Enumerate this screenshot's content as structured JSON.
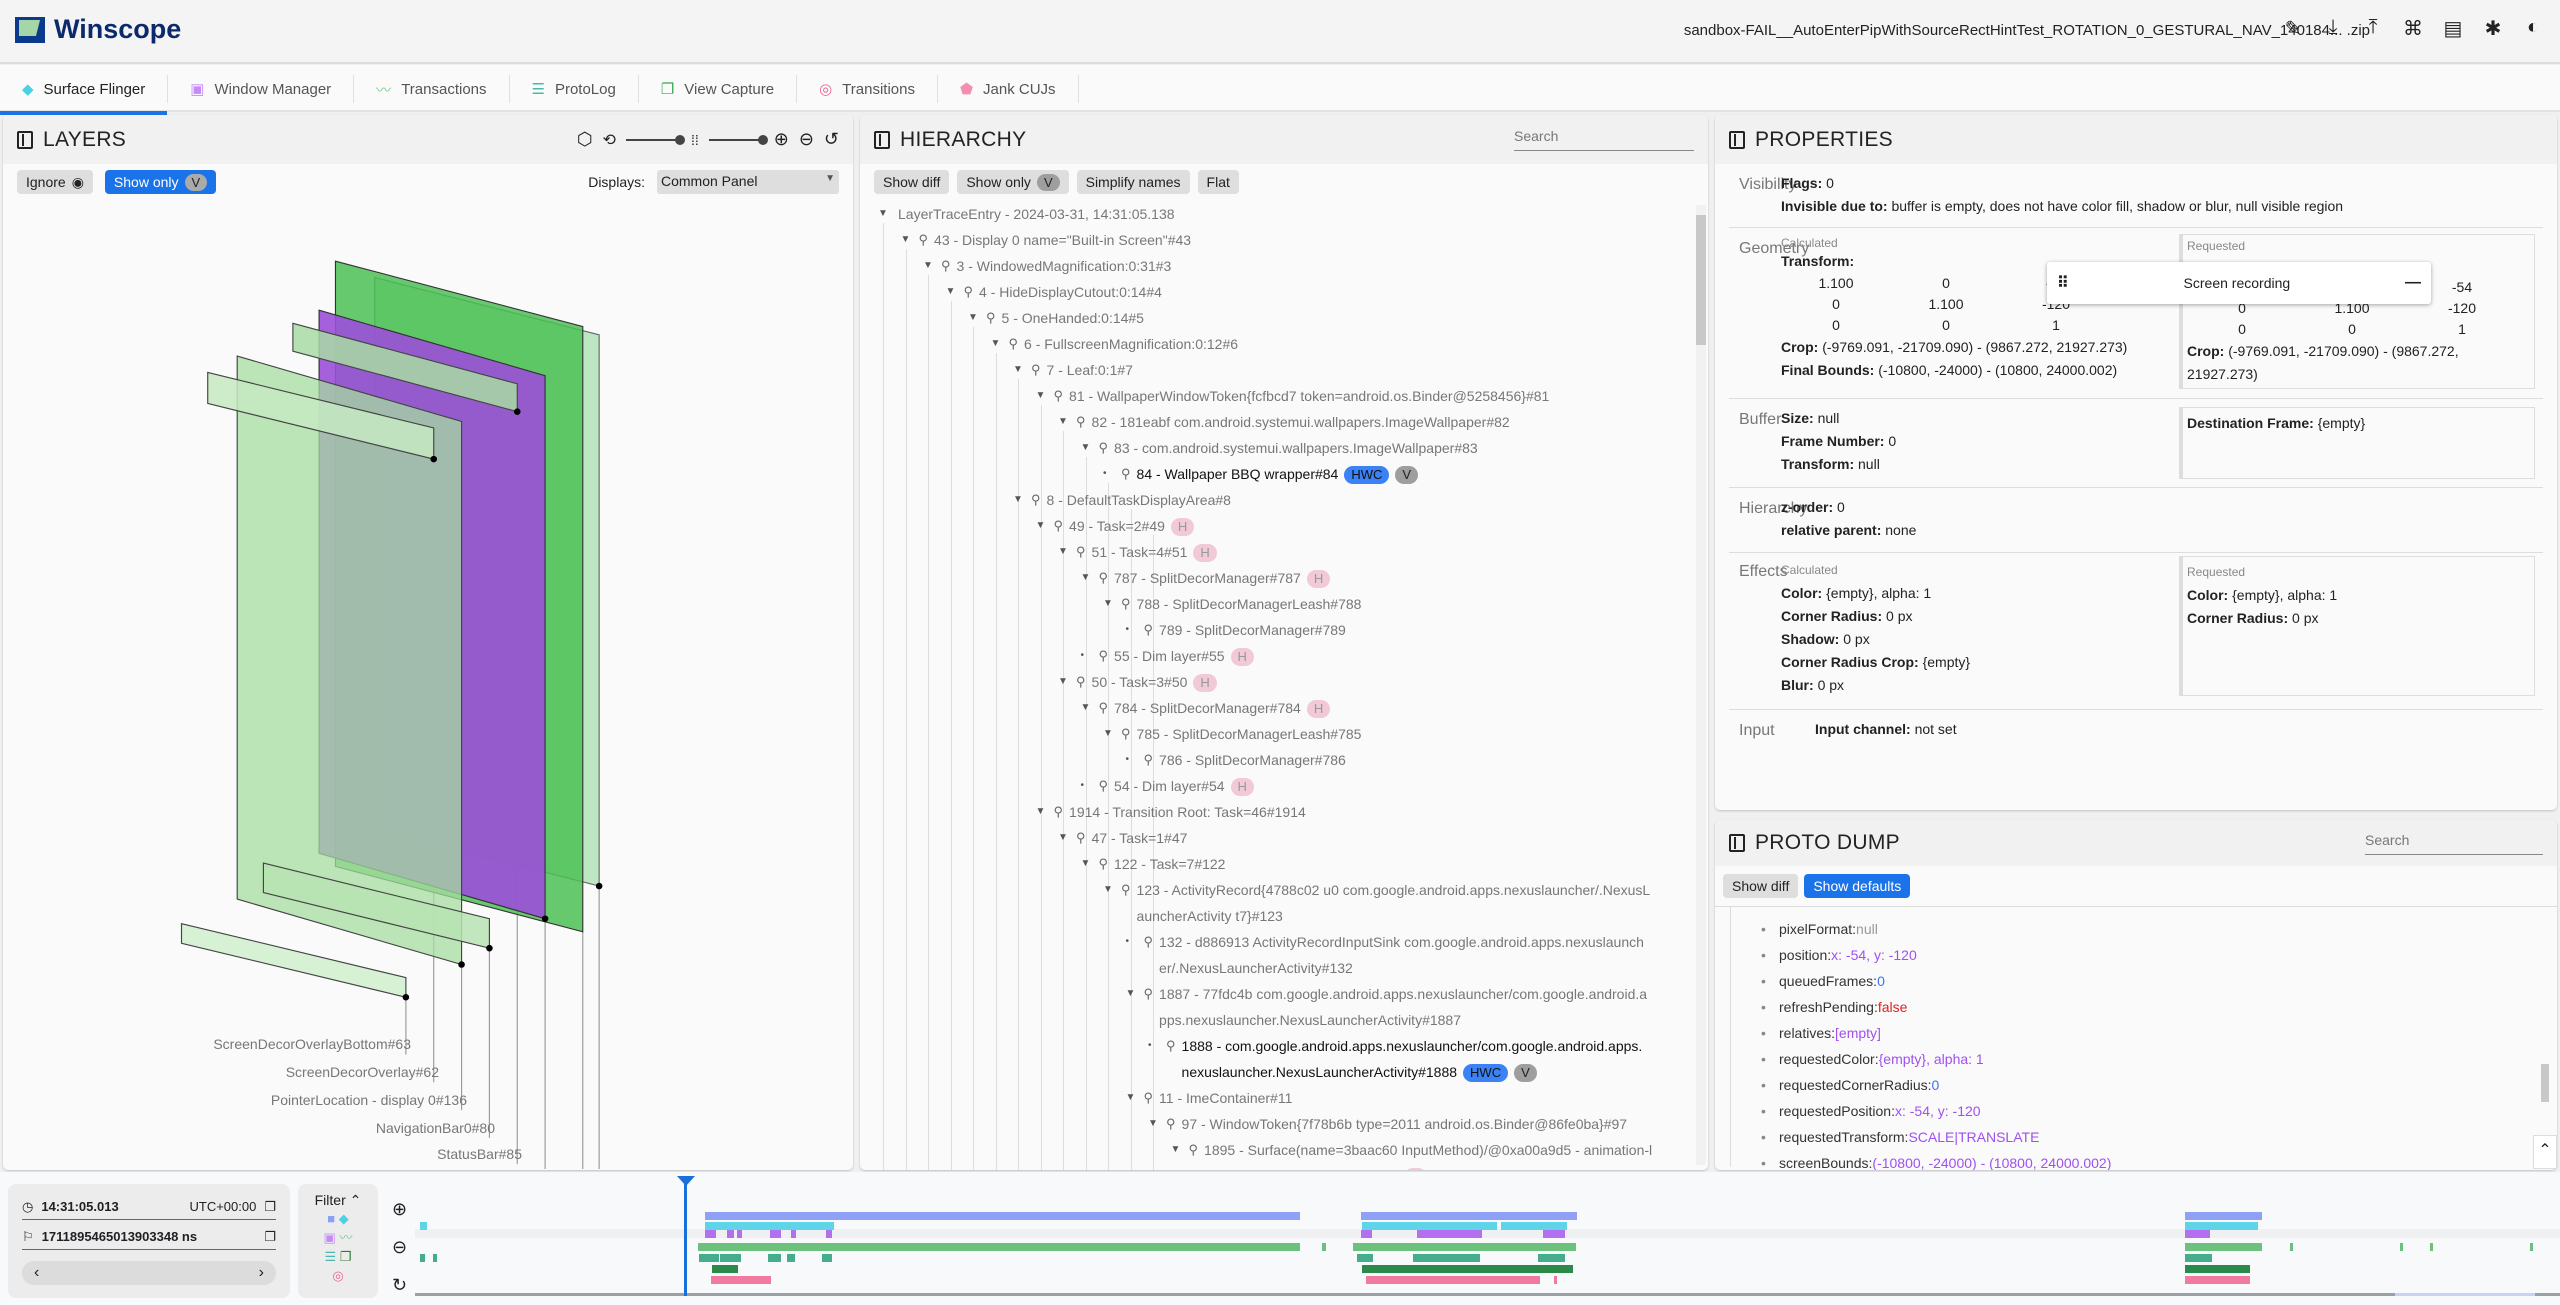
{
  "app": {
    "title": "Winscope",
    "file_name": "sandbox-FAIL__AutoEnterPipWithSourceRectHintTest_ROTATION_0_GESTURAL_NAV_140184... .zip",
    "toolbar_icons": [
      "edit-icon",
      "download-icon",
      "upload-icon",
      "shortcuts-icon",
      "docs-icon",
      "bug-icon",
      "dark-mode-icon"
    ]
  },
  "tabs": [
    {
      "label": "Surface Flinger",
      "icon": "layers-icon",
      "color": "#4dd0e1",
      "active": true
    },
    {
      "label": "Window Manager",
      "icon": "window-icon",
      "color": "#c58af9"
    },
    {
      "label": "Transactions",
      "icon": "chart-line-icon",
      "color": "#81c995"
    },
    {
      "label": "ProtoLog",
      "icon": "list-icon",
      "color": "#4db6ac"
    },
    {
      "label": "View Capture",
      "icon": "copy-icon",
      "color": "#34a853"
    },
    {
      "label": "Transitions",
      "icon": "rings-icon",
      "color": "#f06292"
    },
    {
      "label": "Jank CUJs",
      "icon": "tag-icon",
      "color": "#f48fb1"
    }
  ],
  "layers": {
    "title": "LAYERS",
    "ignore_label": "Ignore",
    "show_only_label": "Show only",
    "show_only_chip": "V",
    "displays_label": "Displays:",
    "displays_value": "Common Panel",
    "labels": [
      "ScreenDecorOverlayBottom#63",
      "ScreenDecorOverlay#62",
      "PointerLocation - display 0#136",
      "NavigationBar0#80",
      "StatusBar#85"
    ]
  },
  "hierarchy": {
    "title": "HIERARCHY",
    "search_placeholder": "Search",
    "buttons": [
      "Show diff",
      "Show only",
      "Simplify names",
      "Flat"
    ],
    "show_only_chip": "V",
    "rows": [
      {
        "d": 0,
        "t": "LayerTraceEntry - 2024-03-31, 14:31:05.138",
        "exp": true,
        "nopin": true
      },
      {
        "d": 1,
        "t": "43 - Display 0 name=\"Built-in Screen\"#43",
        "exp": true
      },
      {
        "d": 2,
        "t": "3 - WindowedMagnification:0:31#3",
        "exp": true
      },
      {
        "d": 3,
        "t": "4 - HideDisplayCutout:0:14#4",
        "exp": true
      },
      {
        "d": 4,
        "t": "5 - OneHanded:0:14#5",
        "exp": true
      },
      {
        "d": 5,
        "t": "6 - FullscreenMagnification:0:12#6",
        "exp": true
      },
      {
        "d": 6,
        "t": "7 - Leaf:0:1#7",
        "exp": true
      },
      {
        "d": 7,
        "t": "81 - WallpaperWindowToken{fcfbcd7 token=android.os.Binder@5258456}#81",
        "exp": true
      },
      {
        "d": 8,
        "t": "82 - 181eabf com.android.systemui.wallpapers.ImageWallpaper#82",
        "exp": true
      },
      {
        "d": 9,
        "t": "83 - com.android.systemui.wallpapers.ImageWallpaper#83",
        "exp": true
      },
      {
        "d": 10,
        "t": "84 - Wallpaper BBQ wrapper#84",
        "sel": true,
        "chips": [
          "HWC",
          "V"
        ]
      },
      {
        "d": 6,
        "t": "8 - DefaultTaskDisplayArea#8",
        "exp": true
      },
      {
        "d": 7,
        "t": "49 - Task=2#49",
        "exp": true,
        "chips": [
          "H"
        ]
      },
      {
        "d": 8,
        "t": "51 - Task=4#51",
        "exp": true,
        "chips": [
          "H"
        ]
      },
      {
        "d": 9,
        "t": "787 - SplitDecorManager#787",
        "exp": true,
        "chips": [
          "H"
        ]
      },
      {
        "d": 10,
        "t": "788 - SplitDecorManagerLeash#788",
        "exp": true
      },
      {
        "d": 11,
        "t": "789 - SplitDecorManager#789"
      },
      {
        "d": 9,
        "t": "55 - Dim layer#55",
        "chips": [
          "H"
        ]
      },
      {
        "d": 8,
        "t": "50 - Task=3#50",
        "exp": true,
        "chips": [
          "H"
        ]
      },
      {
        "d": 9,
        "t": "784 - SplitDecorManager#784",
        "exp": true,
        "chips": [
          "H"
        ]
      },
      {
        "d": 10,
        "t": "785 - SplitDecorManagerLeash#785",
        "exp": true
      },
      {
        "d": 11,
        "t": "786 - SplitDecorManager#786"
      },
      {
        "d": 9,
        "t": "54 - Dim layer#54",
        "chips": [
          "H"
        ]
      },
      {
        "d": 7,
        "t": "1914 - Transition Root: Task=46#1914",
        "exp": true
      },
      {
        "d": 8,
        "t": "47 - Task=1#47",
        "exp": true
      },
      {
        "d": 9,
        "t": "122 - Task=7#122",
        "exp": true
      },
      {
        "d": 10,
        "t": "123 - ActivityRecord{4788c02 u0 com.google.android.apps.nexuslauncher/.NexusL",
        "t2": "auncherActivity t7}#123",
        "exp": true
      },
      {
        "d": 11,
        "t": "132 - d886913 ActivityRecordInputSink com.google.android.apps.nexuslaunch",
        "t2": "er/.NexusLauncherActivity#132"
      },
      {
        "d": 11,
        "t": "1887 - 77fdc4b com.google.android.apps.nexuslauncher/com.google.android.a",
        "t2": "pps.nexuslauncher.NexusLauncherActivity#1887",
        "exp": true
      },
      {
        "d": 12,
        "t": "1888 - com.google.android.apps.nexuslauncher/com.google.android.apps.",
        "t2": "nexuslauncher.NexusLauncherActivity#1888",
        "sel": true,
        "chips": [
          "HWC",
          "V"
        ]
      },
      {
        "d": 11,
        "t": "11 - ImeContainer#11",
        "exp": true
      },
      {
        "d": 12,
        "t": "97 - WindowToken{7f78b6b type=2011 android.os.Binder@86fe0ba}#97",
        "exp": true
      },
      {
        "d": 13,
        "t": "1895 - Surface(name=3baac60 InputMethod)/@0xa00a9d5 - animation-l",
        "t2": "eash of insets_animation#1895",
        "exp": true,
        "chips": [
          "H"
        ]
      }
    ]
  },
  "properties": {
    "title": "PROPERTIES",
    "visibility": {
      "label": "Visibility",
      "flags": "Flags:",
      "flags_v": "0",
      "invis": "Invisible due to:",
      "invis_v": "buffer is empty, does not have color fill, shadow or blur, null visible region"
    },
    "geometry": {
      "label": "Geometry",
      "calc": "Calculated",
      "req": "Requested",
      "transform": "Transform:",
      "calc_matrix": [
        "1.100",
        "0",
        "-54",
        "0",
        "1.100",
        "-120",
        "0",
        "0",
        "1"
      ],
      "req_matrix": [
        "1.100",
        "0",
        "-54",
        "0",
        "1.100",
        "-120",
        "0",
        "0",
        "1"
      ],
      "crop": "Crop:",
      "crop_v": "(-9769.091, -21709.090) - (9867.272, 21927.273)",
      "req_crop_v": "(-9769.091, -21709.090) - (9867.272, 21927.273)",
      "final": "Final Bounds:",
      "final_v": "(-10800, -24000) - (10800, 24000.002)"
    },
    "buffer": {
      "label": "Buffer",
      "size": "Size:",
      "size_v": "null",
      "frame": "Frame Number:",
      "frame_v": "0",
      "transform": "Transform:",
      "transform_v": "null",
      "dest": "Destination Frame:",
      "dest_v": "{empty}"
    },
    "hierarchy": {
      "label": "Hierarchy",
      "z": "z-order:",
      "z_v": "0",
      "rel": "relative parent:",
      "rel_v": "none"
    },
    "effects": {
      "label": "Effects",
      "calc": "Calculated",
      "req": "Requested",
      "color": "Color:",
      "color_v": "{empty}, alpha: 1",
      "cr": "Corner Radius:",
      "cr_v": "0 px",
      "shadow": "Shadow:",
      "shadow_v": "0 px",
      "crc": "Corner Radius Crop:",
      "crc_v": "{empty}",
      "blur": "Blur:",
      "blur_v": "0 px",
      "req_color_v": "{empty}, alpha: 1",
      "req_cr_v": "0 px"
    },
    "input": {
      "label": "Input",
      "ch": "Input channel:",
      "ch_v": "not set"
    }
  },
  "screen_recording": {
    "title": "Screen recording"
  },
  "proto": {
    "title": "PROTO DUMP",
    "search_placeholder": "Search",
    "show_diff": "Show diff",
    "show_defaults": "Show defaults",
    "rows": [
      {
        "k": "pixelFormat:",
        "v": "null",
        "c": "gray"
      },
      {
        "k": "position:",
        "v": "x: -54, y: -120",
        "c": "purple"
      },
      {
        "k": "queuedFrames:",
        "v": "0",
        "c": "blue"
      },
      {
        "k": "refreshPending:",
        "v": "false",
        "c": "red"
      },
      {
        "k": "relatives:",
        "v": "[empty]",
        "c": "purple"
      },
      {
        "k": "requestedColor:",
        "v": "{empty}, alpha: 1",
        "c": "purple"
      },
      {
        "k": "requestedCornerRadius:",
        "v": "0",
        "c": "blue"
      },
      {
        "k": "requestedPosition:",
        "v": "x: -54, y: -120",
        "c": "purple"
      },
      {
        "k": "requestedTransform:",
        "v": "SCALE|TRANSLATE",
        "c": "purple"
      },
      {
        "k": "screenBounds:",
        "v": "(-10800, -24000) - (10800, 24000.002)",
        "c": "purple"
      }
    ]
  },
  "timeline": {
    "time": "14:31:05.013",
    "tz": "UTC+00:00",
    "ns": "1711895465013903348 ns",
    "filter_label": "Filter"
  }
}
